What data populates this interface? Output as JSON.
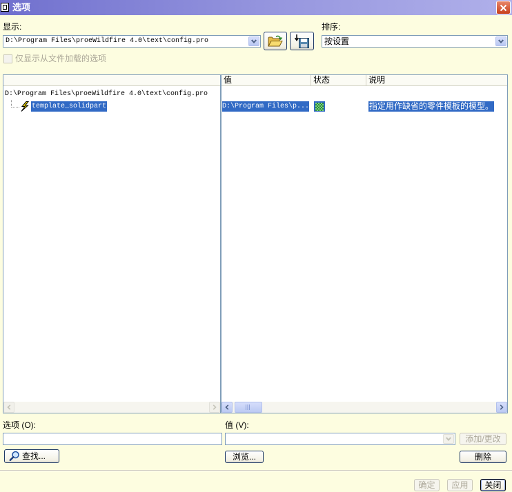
{
  "window": {
    "title": "选项",
    "icon": "window-icon",
    "close_icon": "close-icon"
  },
  "theme": {
    "selection": "#316ac5",
    "background": "#fdfde0",
    "border": "#7f9db9"
  },
  "display": {
    "label": "显示:",
    "value": "D:\\Program Files\\proeWildfire 4.0\\text\\config.pro",
    "open_icon": "open-folder-icon",
    "save_icon": "save-icon"
  },
  "sort": {
    "label": "排序:",
    "value": "按设置"
  },
  "filter": {
    "label": "仅显示从文件加载的选项",
    "checked": false,
    "enabled": false
  },
  "tree": {
    "root": "D:\\Program Files\\proeWildfire 4.0\\text\\config.pro",
    "items": [
      {
        "label": "template_solidpart",
        "icon": "lightning-icon",
        "selected": true
      }
    ]
  },
  "table": {
    "columns": [
      {
        "label": "值"
      },
      {
        "label": "状态"
      },
      {
        "label": "说明"
      }
    ],
    "rows": [
      {
        "value": "D:\\Program Files\\p...",
        "status_icon": "status-icon",
        "description": "指定用作缺省的零件模板的模型。",
        "selected": true
      }
    ]
  },
  "option_field": {
    "label": "选项 (O):",
    "value": ""
  },
  "value_field": {
    "label": "值 (V):",
    "value": "",
    "enabled": false
  },
  "buttons": {
    "find": {
      "label": "查找...",
      "icon": "search-icon",
      "enabled": true
    },
    "browse": {
      "label": "浏览...",
      "enabled": true
    },
    "add_change": {
      "label": "添加/更改",
      "enabled": false
    },
    "delete": {
      "label": "删除",
      "enabled": true
    },
    "ok": {
      "label": "确定",
      "enabled": false
    },
    "apply": {
      "label": "应用",
      "enabled": false
    },
    "close": {
      "label": "关闭",
      "enabled": true,
      "default": true
    }
  }
}
